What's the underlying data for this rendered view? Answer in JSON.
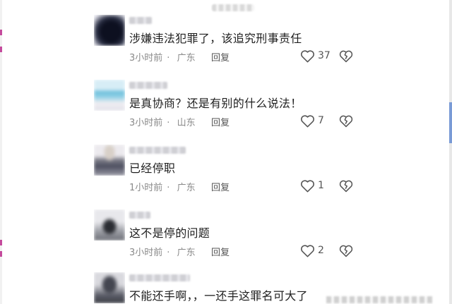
{
  "comments": [
    {
      "avatar": "blurred-avatar-dark",
      "text": "涉嫌违法犯罪了，该追究刑事责任",
      "time": "3小时前",
      "location": "广东",
      "reply": "回复",
      "likes": "37"
    },
    {
      "avatar": "blurred-avatar-light-blue",
      "text": "是真协商？还是有别的什么说法！",
      "time": "3小时前",
      "location": "山东",
      "reply": "回复",
      "likes": "7"
    },
    {
      "avatar": "blurred-avatar-person",
      "text": "已经停职",
      "time": "1小时前",
      "location": "广东",
      "reply": "回复",
      "likes": "1"
    },
    {
      "avatar": "blurred-avatar-figure",
      "text": "这不是停的问题",
      "time": "3小时前",
      "location": "广东",
      "reply": "回复",
      "likes": "2"
    },
    {
      "avatar": "blurred-avatar-person-dark",
      "text": "不能还手啊，，一还手这罪名可大了",
      "time": "",
      "location": "",
      "reply": "",
      "likes": ""
    }
  ],
  "icons": {
    "like": "heart-outline-icon",
    "dislike": "broken-heart-icon"
  },
  "colors": {
    "text": "#1f1f1f",
    "meta": "#8a8a8a",
    "icon": "#555555"
  }
}
